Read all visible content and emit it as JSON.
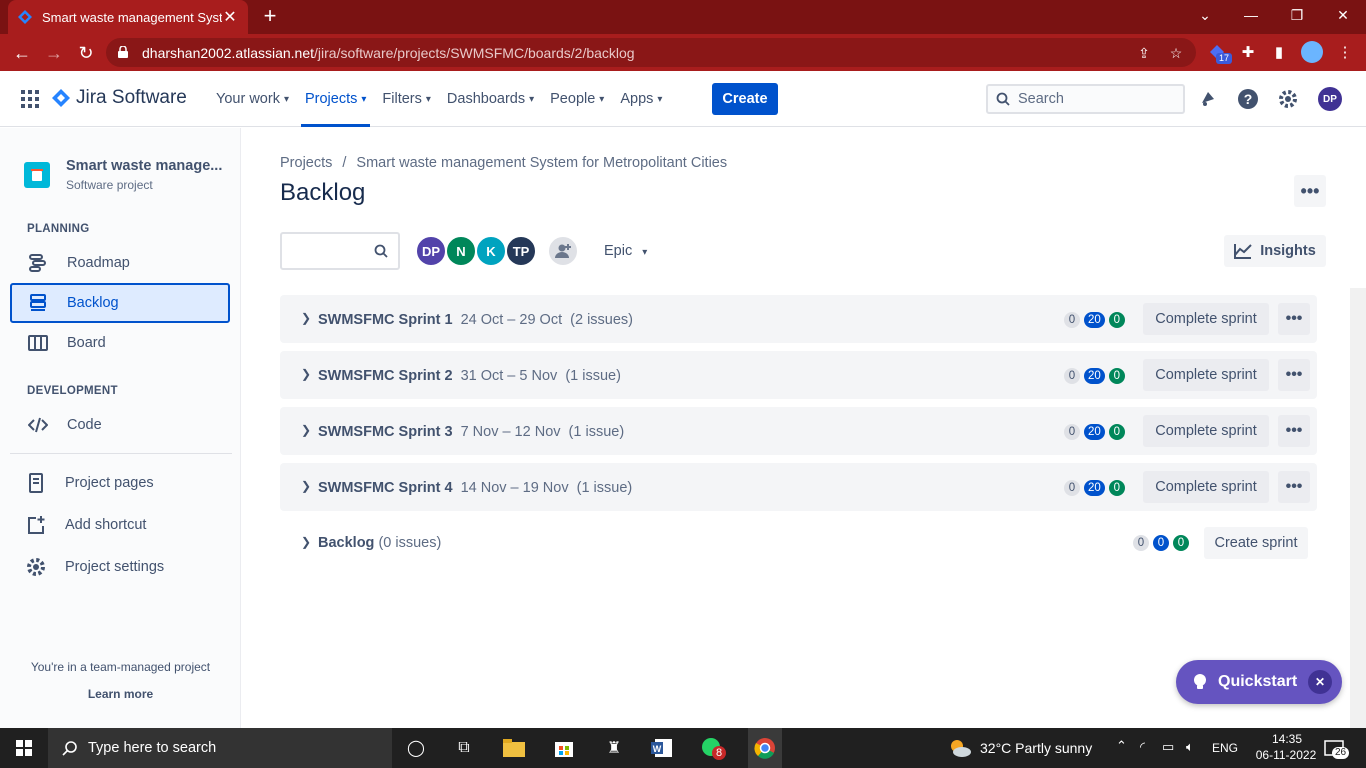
{
  "browser": {
    "tab_title": "Smart waste management System for Metropolitant Cities",
    "url_host": "dharshan2002.atlassian.net",
    "url_path": "/jira/software/projects/SWMSFMC/boards/2/backlog",
    "extension_badge": "17"
  },
  "jira_nav": {
    "product_name": "Jira Software",
    "items": [
      {
        "label": "Your work"
      },
      {
        "label": "Projects"
      },
      {
        "label": "Filters"
      },
      {
        "label": "Dashboards"
      },
      {
        "label": "People"
      },
      {
        "label": "Apps"
      }
    ],
    "active_item": "Projects",
    "create_label": "Create",
    "search_placeholder": "Search",
    "user_initials": "DP"
  },
  "sidebar": {
    "project_name": "Smart waste manage...",
    "project_type": "Software project",
    "planning_title": "PLANNING",
    "planning_items": [
      {
        "label": "Roadmap",
        "icon": "roadmap-icon"
      },
      {
        "label": "Backlog",
        "icon": "backlog-icon",
        "selected": true
      },
      {
        "label": "Board",
        "icon": "board-icon"
      }
    ],
    "development_title": "DEVELOPMENT",
    "development_items": [
      {
        "label": "Code",
        "icon": "code-icon"
      }
    ],
    "extra_items": [
      {
        "label": "Project pages",
        "icon": "page-icon"
      },
      {
        "label": "Add shortcut",
        "icon": "add-shortcut-icon"
      },
      {
        "label": "Project settings",
        "icon": "gear-icon"
      }
    ],
    "footer_text": "You're in a team-managed project",
    "footer_link": "Learn more"
  },
  "main": {
    "breadcrumb_root": "Projects",
    "breadcrumb_separator": "/",
    "breadcrumb_project": "Smart waste management System for Metropolitant Cities",
    "title": "Backlog",
    "avatars": [
      {
        "initials": "DP",
        "color": "#5243aa"
      },
      {
        "initials": "N",
        "color": "#00875a"
      },
      {
        "initials": "K",
        "color": "#00a3bf"
      },
      {
        "initials": "TP",
        "color": "#253858"
      }
    ],
    "epic_label": "Epic",
    "insights_label": "Insights",
    "sprints": [
      {
        "name": "SWMSFMC Sprint 1",
        "dates": "24 Oct – 29 Oct",
        "issues": "(2 issues)",
        "todo": "0",
        "in_progress": "20",
        "done": "0",
        "action": "Complete sprint"
      },
      {
        "name": "SWMSFMC Sprint 2",
        "dates": "31 Oct – 5 Nov",
        "issues": "(1 issue)",
        "todo": "0",
        "in_progress": "20",
        "done": "0",
        "action": "Complete sprint"
      },
      {
        "name": "SWMSFMC Sprint 3",
        "dates": "7 Nov – 12 Nov",
        "issues": "(1 issue)",
        "todo": "0",
        "in_progress": "20",
        "done": "0",
        "action": "Complete sprint"
      },
      {
        "name": "SWMSFMC Sprint 4",
        "dates": "14 Nov – 19 Nov",
        "issues": "(1 issue)",
        "todo": "0",
        "in_progress": "20",
        "done": "0",
        "action": "Complete sprint"
      }
    ],
    "backlog": {
      "name": "Backlog",
      "issues": "(0 issues)",
      "todo": "0",
      "in_progress": "0",
      "done": "0",
      "action": "Create sprint"
    },
    "quickstart_label": "Quickstart"
  },
  "taskbar": {
    "search_placeholder": "Type here to search",
    "whatsapp_badge": "8",
    "weather": "32°C  Partly sunny",
    "language": "ENG",
    "time": "14:35",
    "date": "06-11-2022",
    "notification_count": "26"
  },
  "colors": {
    "brand_blue": "#0052cc",
    "browser_red": "#a81d1d",
    "quickstart_purple": "#6554c0"
  }
}
